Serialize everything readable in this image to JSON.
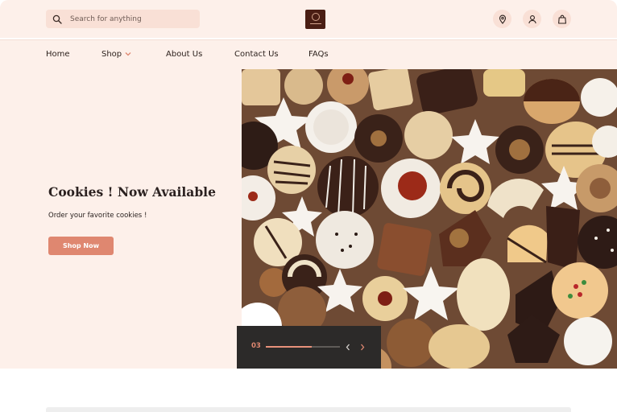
{
  "header": {
    "search": {
      "placeholder": "Search for anything",
      "value": ""
    },
    "icons": [
      "location-pin-icon",
      "user-icon",
      "shopping-bag-icon"
    ]
  },
  "nav": {
    "items": [
      {
        "label": "Home"
      },
      {
        "label": "Shop",
        "has_dropdown": true
      },
      {
        "label": "About Us"
      },
      {
        "label": "Contact Us"
      },
      {
        "label": "FAQs"
      }
    ]
  },
  "hero": {
    "title": "Cookies ! Now Available",
    "subtitle": "Order your favorite cookies !",
    "cta_label": "Shop Now",
    "slider": {
      "current": "03",
      "progress": 0.62
    }
  },
  "colors": {
    "background": "#fdf0ea",
    "accent": "#df8770",
    "search_bg": "#f9e0d6",
    "dark_panel": "#2c2a29",
    "logo_bg": "#4a1e14"
  }
}
